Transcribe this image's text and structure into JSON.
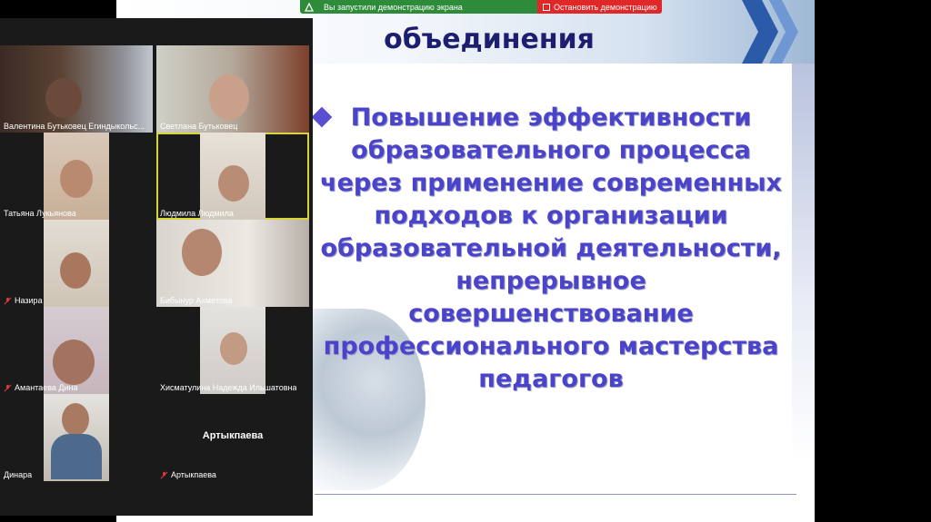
{
  "share_bar": {
    "message": "Вы запустили демонстрацию экрана",
    "stop_label": "Остановить демонстрацию",
    "colors": {
      "bar": "#2e8b3a",
      "stop": "#e02828"
    }
  },
  "slide": {
    "title": "Тема методического\nобъединения",
    "body": "Повышение эффективности образовательного процесса через применение современных подходов к организации образовательной деятельности, непрерывное совершенствование профессионального мастерства педагогов",
    "colors": {
      "title": "#1e1e70",
      "body": "#4b43c9"
    }
  },
  "participants": [
    {
      "name": "Валентина Бутьковец  Егиндыкольс...",
      "muted": false,
      "active": false
    },
    {
      "name": "Светлана Бутьковец",
      "muted": false,
      "active": false
    },
    {
      "name": "Татьяна Лукьянова",
      "muted": false,
      "active": false
    },
    {
      "name": "Людмила Людмила",
      "muted": false,
      "active": true
    },
    {
      "name": "Назира",
      "muted": true,
      "active": false
    },
    {
      "name": "Бибынур Ахметова",
      "muted": false,
      "active": false
    },
    {
      "name": "Амантаева Дина",
      "muted": true,
      "active": false
    },
    {
      "name": "Хисматулина Надежда Ильшатовна",
      "muted": false,
      "active": false
    },
    {
      "name": "Динара",
      "muted": false,
      "active": false
    },
    {
      "name": "Артыкпаева",
      "muted": true,
      "active": false,
      "video_off_label": "Артыкпаева"
    }
  ]
}
